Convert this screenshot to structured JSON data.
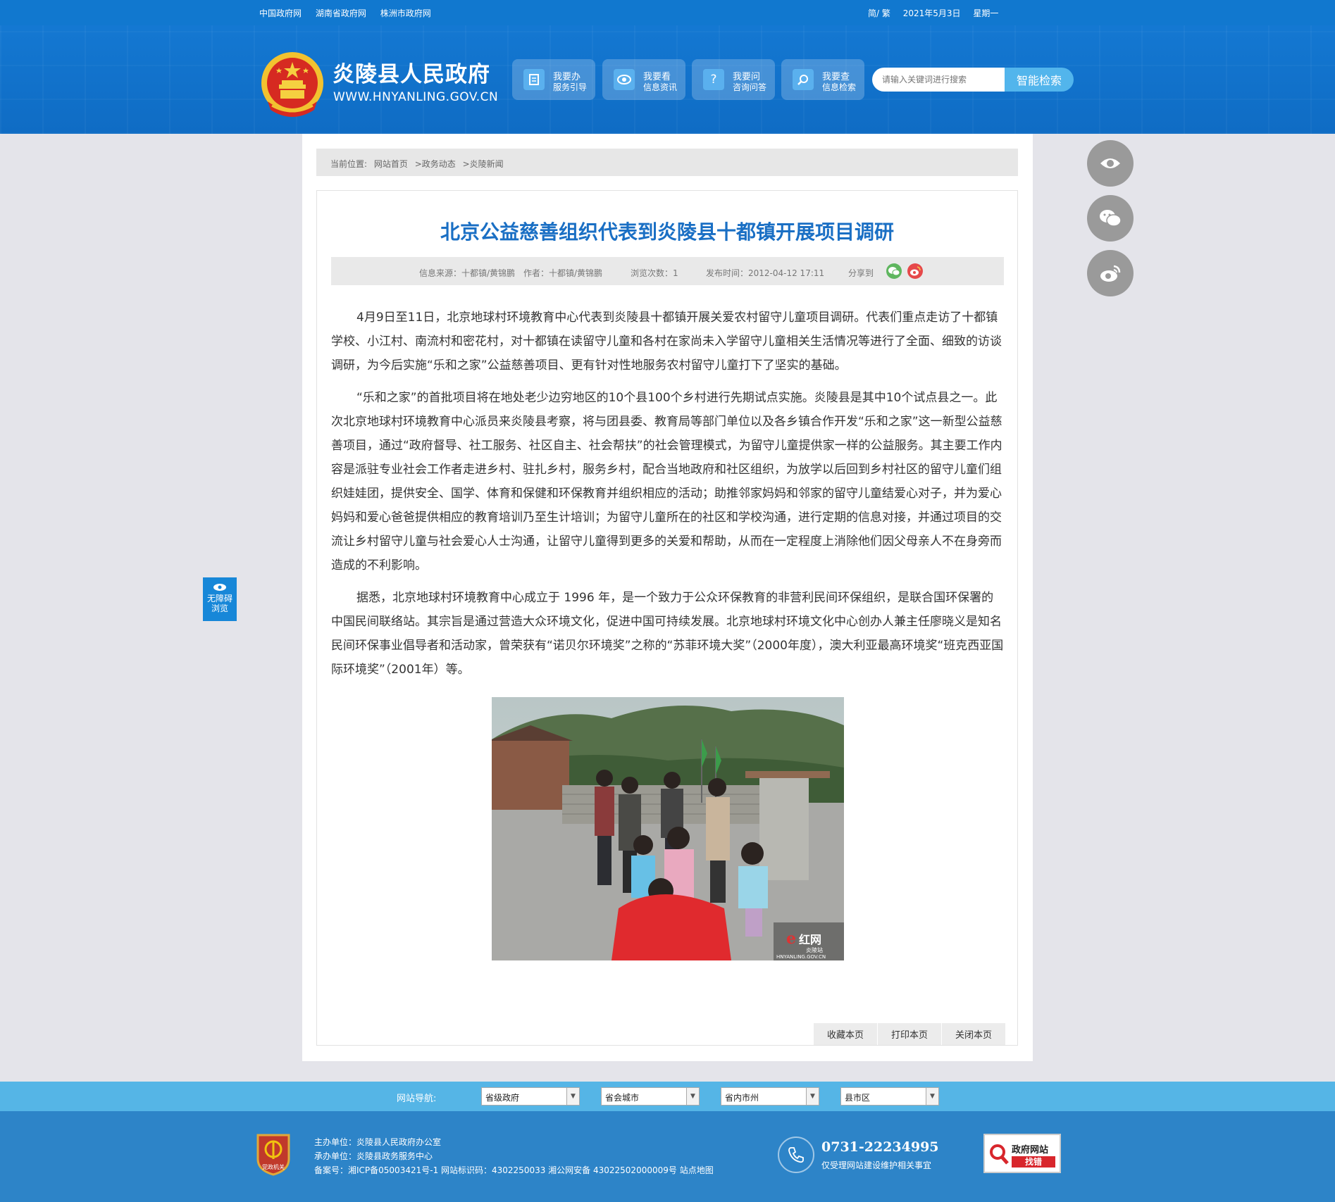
{
  "topbar": {
    "links": [
      "中国政府网",
      "湖南省政府网",
      "株洲市政府网"
    ],
    "lang": "简/ 繁",
    "date": "2021年5月3日",
    "weekday": "星期一"
  },
  "header": {
    "site_name": "炎陵县人民政府",
    "site_domain": "WWW.HNYANLING.GOV.CN",
    "nav": [
      {
        "line1": "我要办",
        "line2": "服务引导",
        "icon": "document-icon"
      },
      {
        "line1": "我要看",
        "line2": "信息资讯",
        "icon": "eye-icon"
      },
      {
        "line1": "我要问",
        "line2": "咨询问答",
        "icon": "question-icon"
      },
      {
        "line1": "我要查",
        "line2": "信息检索",
        "icon": "search-icon"
      }
    ],
    "search_placeholder": "请输入关键词进行搜索",
    "search_button": "智能检索"
  },
  "breadcrumb": {
    "label": "当前位置:",
    "items": [
      "网站首页",
      ">政务动态",
      ">炎陵新闻"
    ]
  },
  "article": {
    "title": "北京公益慈善组织代表到炎陵县十都镇开展项目调研",
    "meta": {
      "source": "信息来源：十都镇/黄锦鹏",
      "author": "作者：十都镇/黄锦鹏",
      "views": "浏览次数：1",
      "published": "发布时间：2012-04-12 17:11",
      "share": "分享到"
    },
    "paragraphs": [
      "4月9日至11日，北京地球村环境教育中心代表到炎陵县十都镇开展关爱农村留守儿童项目调研。代表们重点走访了十都镇学校、小江村、南流村和密花村，对十都镇在读留守儿童和各村在家尚未入学留守儿童相关生活情况等进行了全面、细致的访谈调研，为今后实施“乐和之家”公益慈善项目、更有针对性地服务农村留守儿童打下了坚实的基础。",
      "“乐和之家”的首批项目将在地处老少边穷地区的10个县100个乡村进行先期试点实施。炎陵县是其中10个试点县之一。此次北京地球村环境教育中心派员来炎陵县考察，将与团县委、教育局等部门单位以及各乡镇合作开发“乐和之家”这一新型公益慈善项目，通过“政府督导、社工服务、社区自主、社会帮扶”的社会管理模式，为留守儿童提供家一样的公益服务。其主要工作内容是派驻专业社会工作者走进乡村、驻扎乡村，服务乡村，配合当地政府和社区组织，为放学以后回到乡村社区的留守儿童们组织娃娃团，提供安全、国学、体育和保健和环保教育并组织相应的活动；助推邻家妈妈和邻家的留守儿童结爱心对子，并为爱心妈妈和爱心爸爸提供相应的教育培训乃至生计培训；为留守儿童所在的社区和学校沟通，进行定期的信息对接，并通过项目的交流让乡村留守儿童与社会爱心人士沟通，让留守儿童得到更多的关爱和帮助，从而在一定程度上消除他们因父母亲人不在身旁而造成的不利影响。",
      "据悉，北京地球村环境教育中心成立于 1996 年，是一个致力于公众环保教育的非营利民间环保组织，是联合国环保署的中国民间联络站。其宗旨是通过营造大众环境文化，促进中国可持续发展。北京地球村环境文化中心创办人兼主任廖晓义是知名民间环保事业倡导者和活动家，曾荣获有“诺贝尔环境奖”之称的“苏菲环境大奖”（2000年度），澳大利亚最高环境奖“班克西亚国际环境奖”（2001年）等。"
    ],
    "photo_watermark": "红网",
    "photo_watermark_sub": "炎陵站",
    "photo_watermark_url": "HNYANLING.GOV.CN",
    "tools": [
      "收藏本页",
      "打印本页",
      "关闭本页"
    ]
  },
  "accessibility": {
    "line1": "无障碍",
    "line2": "浏览"
  },
  "footer_nav": {
    "label": "网站导航:",
    "selects": [
      "省级政府",
      "省会城市",
      "省内市州",
      "县市区"
    ]
  },
  "footer": {
    "badge_text": "党政机关",
    "sponsor": "主办单位：炎陵县人民政府办公室",
    "organizer": "承办单位：炎陵县政务服务中心",
    "record": "备案号：湘ICP备05003421号-1 网站标识码：4302250033 湘公网安备 43022502000009号 站点地图",
    "phone": "0731-22234995",
    "phone_note": "仅受理网站建设维护相关事宜",
    "jiucuo_line1": "政府网站",
    "jiucuo_line2": "找错"
  },
  "colors": {
    "brand_blue": "#1178cf",
    "title_blue": "#1a6fc4",
    "footer_blue": "#2d84c8",
    "footnav_blue": "#55b5e6"
  }
}
